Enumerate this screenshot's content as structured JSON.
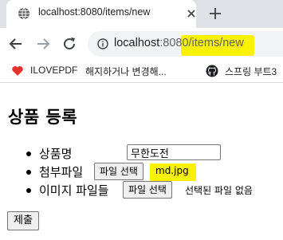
{
  "browser": {
    "tab": {
      "title": "localhost:8080/items/new",
      "icon": "globe-icon"
    },
    "new_tab_icon": "plus-icon",
    "url": {
      "host": "localhost",
      "port": ":8080",
      "path": "/items/new"
    },
    "nav": {
      "back": "back-arrow-icon",
      "forward": "forward-arrow-icon",
      "reload": "reload-icon"
    },
    "bookmarks": [
      {
        "label": "ILOVEPDF",
        "icon": "heart-icon"
      },
      {
        "label": "해지하거나 변경해...",
        "icon": "github-icon"
      },
      {
        "label": "스프링 부트3",
        "icon": "github-icon"
      }
    ],
    "highlight_color": "#faf200"
  },
  "page": {
    "title": "상품 등록",
    "fields": {
      "name": {
        "label": "상품명",
        "value": "무한도전"
      },
      "attach": {
        "label": "첨부파일",
        "button": "파일 선택",
        "status": "md.jpg"
      },
      "images": {
        "label": "이미지 파일들",
        "button": "파일 선택",
        "status": "선택된 파일 없음"
      }
    },
    "submit_label": "제출"
  }
}
